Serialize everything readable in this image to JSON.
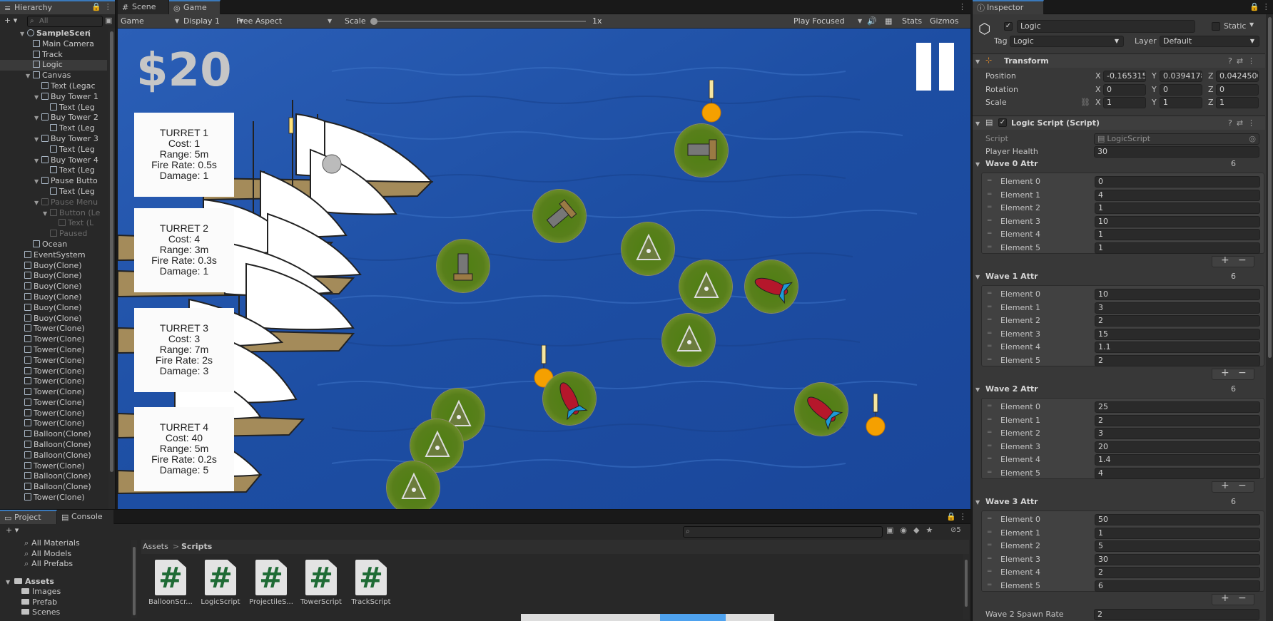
{
  "hierarchy": {
    "tab": "Hierarchy",
    "search_placeholder": "All",
    "rows": [
      {
        "label": "SampleScen",
        "depth": 0,
        "arrow": "▼",
        "kind": "scene"
      },
      {
        "label": "Main Camera",
        "depth": 1,
        "arrow": "",
        "kind": "go"
      },
      {
        "label": "Track",
        "depth": 1,
        "arrow": "",
        "kind": "go"
      },
      {
        "label": "Logic",
        "depth": 1,
        "arrow": "",
        "kind": "go",
        "selected": true
      },
      {
        "label": "Canvas",
        "depth": 1,
        "arrow": "▼",
        "kind": "go"
      },
      {
        "label": "Text (Legac",
        "depth": 2,
        "arrow": "",
        "kind": "go"
      },
      {
        "label": "Buy Tower 1",
        "depth": 2,
        "arrow": "▼",
        "kind": "go"
      },
      {
        "label": "Text (Leg",
        "depth": 3,
        "arrow": "",
        "kind": "go"
      },
      {
        "label": "Buy Tower 2",
        "depth": 2,
        "arrow": "▼",
        "kind": "go"
      },
      {
        "label": "Text (Leg",
        "depth": 3,
        "arrow": "",
        "kind": "go"
      },
      {
        "label": "Buy Tower 3",
        "depth": 2,
        "arrow": "▼",
        "kind": "go"
      },
      {
        "label": "Text (Leg",
        "depth": 3,
        "arrow": "",
        "kind": "go"
      },
      {
        "label": "Buy Tower 4",
        "depth": 2,
        "arrow": "▼",
        "kind": "go"
      },
      {
        "label": "Text (Leg",
        "depth": 3,
        "arrow": "",
        "kind": "go"
      },
      {
        "label": "Pause Butto",
        "depth": 2,
        "arrow": "▼",
        "kind": "go"
      },
      {
        "label": "Text (Leg",
        "depth": 3,
        "arrow": "",
        "kind": "go"
      },
      {
        "label": "Pause Menu",
        "depth": 2,
        "arrow": "▼",
        "kind": "go",
        "disabled": true
      },
      {
        "label": "Button (Le",
        "depth": 3,
        "arrow": "▼",
        "kind": "go",
        "disabled": true
      },
      {
        "label": "Text (L",
        "depth": 4,
        "arrow": "",
        "kind": "go",
        "disabled": true
      },
      {
        "label": "Paused",
        "depth": 3,
        "arrow": "",
        "kind": "go",
        "disabled": true
      },
      {
        "label": "Ocean",
        "depth": 1,
        "arrow": "",
        "kind": "go"
      },
      {
        "label": "EventSystem",
        "depth": 0,
        "arrow": "",
        "kind": "go"
      },
      {
        "label": "Buoy(Clone)",
        "depth": 0,
        "arrow": "",
        "kind": "go"
      },
      {
        "label": "Buoy(Clone)",
        "depth": 0,
        "arrow": "",
        "kind": "go"
      },
      {
        "label": "Buoy(Clone)",
        "depth": 0,
        "arrow": "",
        "kind": "go"
      },
      {
        "label": "Buoy(Clone)",
        "depth": 0,
        "arrow": "",
        "kind": "go"
      },
      {
        "label": "Buoy(Clone)",
        "depth": 0,
        "arrow": "",
        "kind": "go"
      },
      {
        "label": "Buoy(Clone)",
        "depth": 0,
        "arrow": "",
        "kind": "go"
      },
      {
        "label": "Tower(Clone)",
        "depth": 0,
        "arrow": "",
        "kind": "go"
      },
      {
        "label": "Tower(Clone)",
        "depth": 0,
        "arrow": "",
        "kind": "go"
      },
      {
        "label": "Tower(Clone)",
        "depth": 0,
        "arrow": "",
        "kind": "go"
      },
      {
        "label": "Tower(Clone)",
        "depth": 0,
        "arrow": "",
        "kind": "go"
      },
      {
        "label": "Tower(Clone)",
        "depth": 0,
        "arrow": "",
        "kind": "go"
      },
      {
        "label": "Tower(Clone)",
        "depth": 0,
        "arrow": "",
        "kind": "go"
      },
      {
        "label": "Tower(Clone)",
        "depth": 0,
        "arrow": "",
        "kind": "go"
      },
      {
        "label": "Tower(Clone)",
        "depth": 0,
        "arrow": "",
        "kind": "go"
      },
      {
        "label": "Tower(Clone)",
        "depth": 0,
        "arrow": "",
        "kind": "go"
      },
      {
        "label": "Tower(Clone)",
        "depth": 0,
        "arrow": "",
        "kind": "go"
      },
      {
        "label": "Balloon(Clone)",
        "depth": 0,
        "arrow": "",
        "kind": "go"
      },
      {
        "label": "Balloon(Clone)",
        "depth": 0,
        "arrow": "",
        "kind": "go"
      },
      {
        "label": "Balloon(Clone)",
        "depth": 0,
        "arrow": "",
        "kind": "go"
      },
      {
        "label": "Tower(Clone)",
        "depth": 0,
        "arrow": "",
        "kind": "go"
      },
      {
        "label": "Balloon(Clone)",
        "depth": 0,
        "arrow": "",
        "kind": "go"
      },
      {
        "label": "Balloon(Clone)",
        "depth": 0,
        "arrow": "",
        "kind": "go"
      },
      {
        "label": "Tower(Clone)",
        "depth": 0,
        "arrow": "",
        "kind": "go"
      }
    ]
  },
  "game": {
    "tabs": {
      "scene": "Scene",
      "game": "Game"
    },
    "toolbar": {
      "mode": "Game",
      "display": "Display 1",
      "aspect": "Free Aspect",
      "scale_label": "Scale",
      "scale_value": "1x",
      "play_focused": "Play Focused",
      "stats": "Stats",
      "gizmos": "Gizmos"
    },
    "money": "$20",
    "turrets": [
      {
        "title": "TURRET 1",
        "cost": "Cost: 1",
        "range": "Range: 5m",
        "fire_rate": "Fire Rate: 0.5s",
        "damage": "Damage: 1"
      },
      {
        "title": "TURRET 2",
        "cost": "Cost: 4",
        "range": "Range: 3m",
        "fire_rate": "Fire Rate: 0.3s",
        "damage": "Damage: 1"
      },
      {
        "title": "TURRET 3",
        "cost": "Cost: 3",
        "range": "Range: 7m",
        "fire_rate": "Fire Rate: 2s",
        "damage": "Damage: 3"
      },
      {
        "title": "TURRET 4",
        "cost": "Cost: 40",
        "range": "Range: 5m",
        "fire_rate": "Fire Rate: 0.2s",
        "damage": "Damage: 5"
      }
    ],
    "colors": {
      "ocean": "#1f4fa3",
      "tower_green": "#587f1b",
      "buoy_orange": "#f5a000"
    }
  },
  "inspector": {
    "tab": "Inspector",
    "object_name": "Logic",
    "static_label": "Static",
    "tag_label": "Tag",
    "tag_value": "Logic",
    "layer_label": "Layer",
    "layer_value": "Default",
    "transform": {
      "title": "Transform",
      "position_label": "Position",
      "rotation_label": "Rotation",
      "scale_label": "Scale",
      "position": {
        "x": "-0.165315",
        "y": "0.0394178",
        "z": "0.0424506"
      },
      "rotation": {
        "x": "0",
        "y": "0",
        "z": "0"
      },
      "scale": {
        "x": "1",
        "y": "1",
        "z": "1"
      }
    },
    "logic_script": {
      "title": "Logic Script (Script)",
      "script_label": "Script",
      "script_value": "LogicScript",
      "player_health_label": "Player Health",
      "player_health": "30"
    },
    "waves": [
      {
        "label": "Wave 0 Attr",
        "size": "6",
        "elements": [
          "0",
          "4",
          "1",
          "10",
          "1",
          "1"
        ]
      },
      {
        "label": "Wave 1 Attr",
        "size": "6",
        "elements": [
          "10",
          "3",
          "2",
          "15",
          "1.1",
          "2"
        ]
      },
      {
        "label": "Wave 2 Attr",
        "size": "6",
        "elements": [
          "25",
          "2",
          "3",
          "20",
          "1.4",
          "4"
        ]
      },
      {
        "label": "Wave 3 Attr",
        "size": "6",
        "elements": [
          "50",
          "1",
          "5",
          "30",
          "2",
          "6"
        ]
      }
    ],
    "element_labels": [
      "Element 0",
      "Element 1",
      "Element 2",
      "Element 3",
      "Element 4",
      "Element 5"
    ],
    "wave2_spawn_label": "Wave 2 Spawn Rate",
    "wave2_spawn_value": "2"
  },
  "project": {
    "tabs": {
      "project": "Project",
      "console": "Console"
    },
    "favorites": [
      "All Materials",
      "All Models",
      "All Prefabs"
    ],
    "assets_root": "Assets",
    "folders": [
      "Images",
      "Prefab",
      "Scenes"
    ],
    "breadcrumb_root": "Assets",
    "breadcrumb_leaf": "Scripts",
    "badge_count": "5",
    "files": [
      "BalloonScr...",
      "LogicScript",
      "ProjectileS...",
      "TowerScript",
      "TrackScript"
    ]
  }
}
